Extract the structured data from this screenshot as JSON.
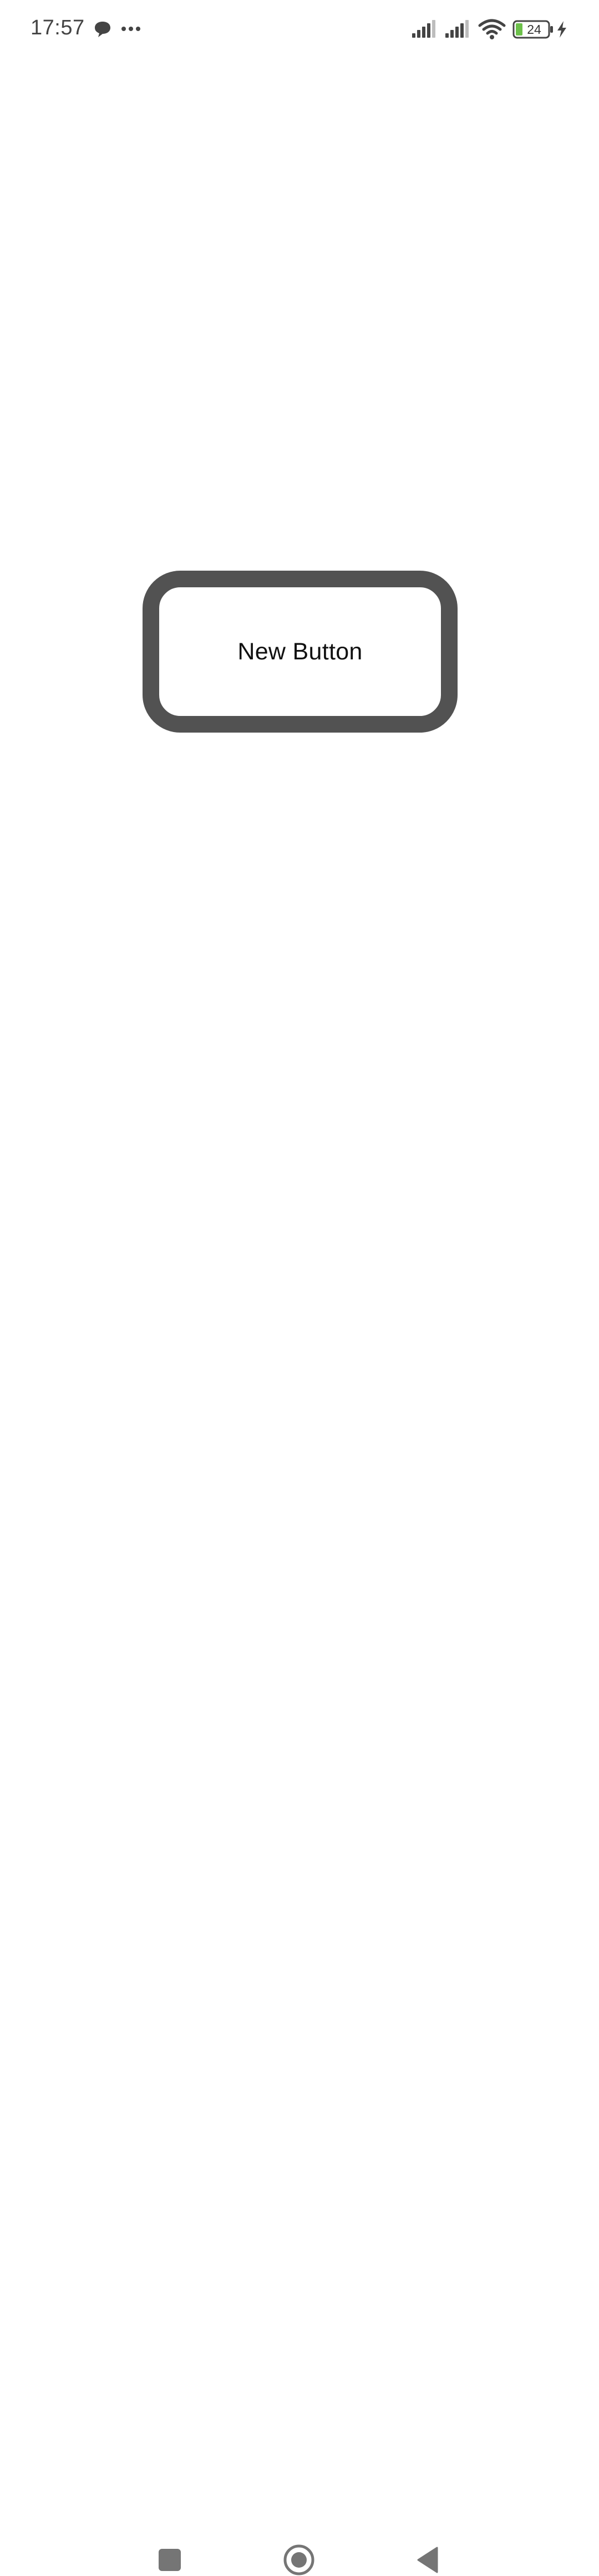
{
  "status_bar": {
    "time": "17:57",
    "battery_level": "24",
    "icons": {
      "notification": "chat-bubble-icon",
      "more": "more-dots-icon",
      "signal_1": "cellular-signal-icon",
      "signal_2": "cellular-signal-icon",
      "wifi": "wifi-icon",
      "battery": "battery-icon",
      "charging": "charging-bolt-icon"
    },
    "colors": {
      "text": "#444444",
      "battery_fill": "#6cc04a"
    }
  },
  "main": {
    "button_label": "New Button",
    "button_border_color": "#525252"
  },
  "nav_bar": {
    "icons": {
      "recents": "square-icon",
      "home": "circle-icon",
      "back": "triangle-back-icon"
    },
    "color": "#757575"
  }
}
